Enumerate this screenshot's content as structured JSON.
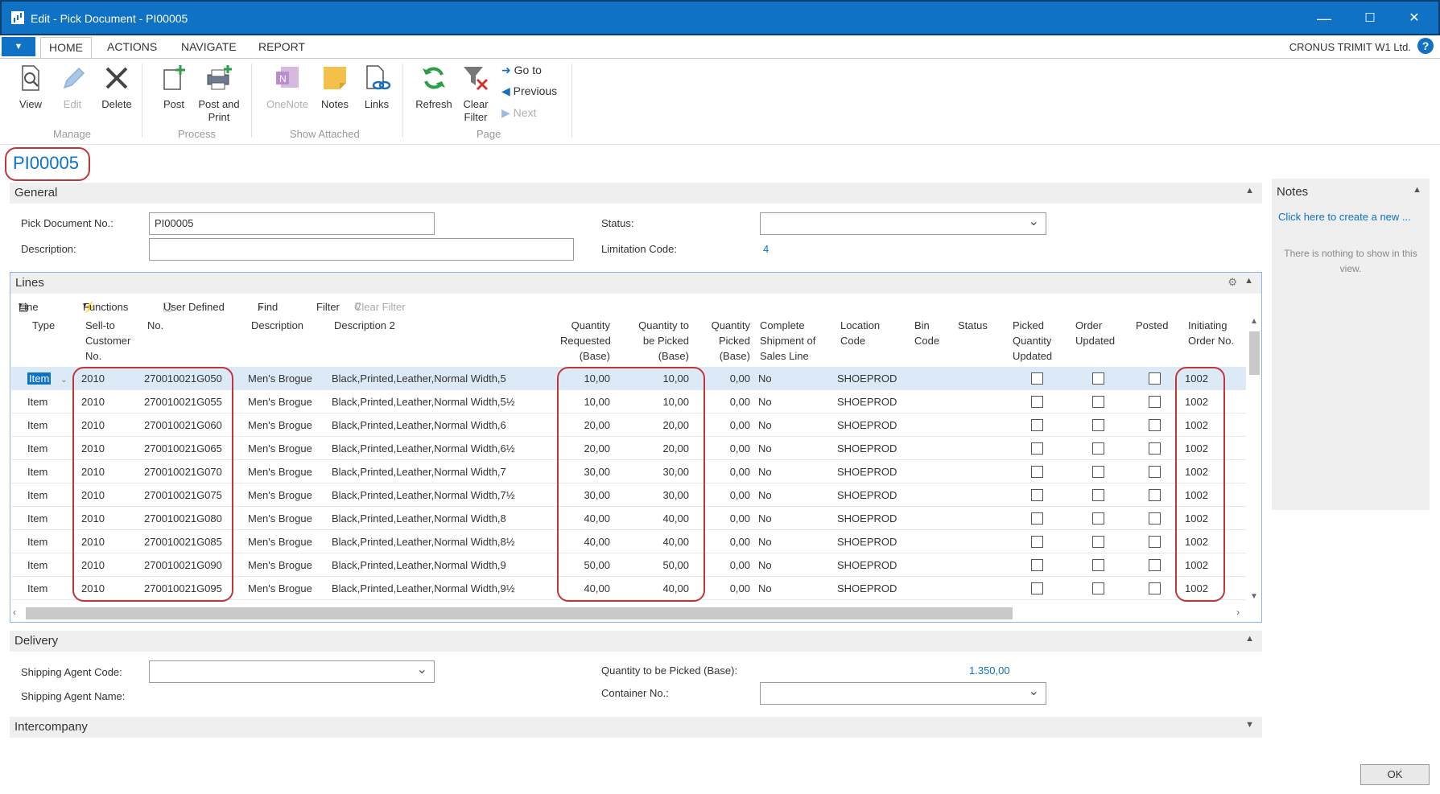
{
  "window": {
    "title": "Edit - Pick Document - PI00005",
    "minimize": "—",
    "maximize": "☐",
    "close": "✕"
  },
  "ribbon_tabs": [
    "HOME",
    "ACTIONS",
    "NAVIGATE",
    "REPORT"
  ],
  "company": "CRONUS TRIMIT W1 Ltd.",
  "ribbon": {
    "manage": {
      "label": "Manage",
      "view": "View",
      "edit": "Edit",
      "delete": "Delete"
    },
    "process": {
      "label": "Process",
      "post": "Post",
      "post_print_1": "Post and",
      "post_print_2": "Print"
    },
    "show_attached": {
      "label": "Show Attached",
      "onenote": "OneNote",
      "notes": "Notes",
      "links": "Links"
    },
    "page": {
      "label": "Page",
      "refresh": "Refresh",
      "clear_filter_1": "Clear",
      "clear_filter_2": "Filter",
      "go_to": "Go to",
      "previous": "Previous",
      "next": "Next"
    }
  },
  "page_title": "PI00005",
  "general": {
    "header": "General",
    "pick_doc_label": "Pick Document No.:",
    "pick_doc_value": "PI00005",
    "description_label": "Description:",
    "description_value": "",
    "status_label": "Status:",
    "status_value": "",
    "limitation_label": "Limitation Code:",
    "limitation_value": "4"
  },
  "lines": {
    "header": "Lines",
    "toolbar": {
      "line": "Line",
      "functions": "Functions",
      "user_defined": "User Defined",
      "find": "Find",
      "filter": "Filter",
      "clear_filter": "Clear Filter"
    },
    "columns": {
      "type": [
        "Type"
      ],
      "sell_to": [
        "Sell-to",
        "Customer",
        "No."
      ],
      "no": [
        "No."
      ],
      "description": [
        "Description"
      ],
      "description2": [
        "Description 2"
      ],
      "qty_requested": [
        "Quantity",
        "Requested",
        "(Base)"
      ],
      "qty_to_pick": [
        "Quantity to",
        "be Picked",
        "(Base)"
      ],
      "qty_picked": [
        "Quantity",
        "Picked",
        "(Base)"
      ],
      "complete_shipment": [
        "Complete",
        "Shipment of",
        "Sales Line"
      ],
      "location": [
        "Location",
        "Code"
      ],
      "bin": [
        "Bin",
        "Code"
      ],
      "status": [
        "Status"
      ],
      "picked_qty_updated": [
        "Picked",
        "Quantity",
        "Updated"
      ],
      "order_updated": [
        "Order",
        "Updated"
      ],
      "posted": [
        "Posted"
      ],
      "initiating": [
        "Initiating",
        "Order No."
      ]
    },
    "rows": [
      {
        "type": "Item",
        "sell_to": "2010",
        "no": "270010021G050",
        "description": "Men's Brogue",
        "description2": "Black,Printed,Leather,Normal Width,5",
        "qty_requested": "10,00",
        "qty_to_pick": "10,00",
        "qty_picked": "0,00",
        "complete": "No",
        "location": "SHOEPROD",
        "bin": "",
        "status": "",
        "picked_updated": false,
        "order_updated": false,
        "posted": false,
        "initiating": "1002"
      },
      {
        "type": "Item",
        "sell_to": "2010",
        "no": "270010021G055",
        "description": "Men's Brogue",
        "description2": "Black,Printed,Leather,Normal Width,5½",
        "qty_requested": "10,00",
        "qty_to_pick": "10,00",
        "qty_picked": "0,00",
        "complete": "No",
        "location": "SHOEPROD",
        "bin": "",
        "status": "",
        "picked_updated": false,
        "order_updated": false,
        "posted": false,
        "initiating": "1002"
      },
      {
        "type": "Item",
        "sell_to": "2010",
        "no": "270010021G060",
        "description": "Men's Brogue",
        "description2": "Black,Printed,Leather,Normal Width,6",
        "qty_requested": "20,00",
        "qty_to_pick": "20,00",
        "qty_picked": "0,00",
        "complete": "No",
        "location": "SHOEPROD",
        "bin": "",
        "status": "",
        "picked_updated": false,
        "order_updated": false,
        "posted": false,
        "initiating": "1002"
      },
      {
        "type": "Item",
        "sell_to": "2010",
        "no": "270010021G065",
        "description": "Men's Brogue",
        "description2": "Black,Printed,Leather,Normal Width,6½",
        "qty_requested": "20,00",
        "qty_to_pick": "20,00",
        "qty_picked": "0,00",
        "complete": "No",
        "location": "SHOEPROD",
        "bin": "",
        "status": "",
        "picked_updated": false,
        "order_updated": false,
        "posted": false,
        "initiating": "1002"
      },
      {
        "type": "Item",
        "sell_to": "2010",
        "no": "270010021G070",
        "description": "Men's Brogue",
        "description2": "Black,Printed,Leather,Normal Width,7",
        "qty_requested": "30,00",
        "qty_to_pick": "30,00",
        "qty_picked": "0,00",
        "complete": "No",
        "location": "SHOEPROD",
        "bin": "",
        "status": "",
        "picked_updated": false,
        "order_updated": false,
        "posted": false,
        "initiating": "1002"
      },
      {
        "type": "Item",
        "sell_to": "2010",
        "no": "270010021G075",
        "description": "Men's Brogue",
        "description2": "Black,Printed,Leather,Normal Width,7½",
        "qty_requested": "30,00",
        "qty_to_pick": "30,00",
        "qty_picked": "0,00",
        "complete": "No",
        "location": "SHOEPROD",
        "bin": "",
        "status": "",
        "picked_updated": false,
        "order_updated": false,
        "posted": false,
        "initiating": "1002"
      },
      {
        "type": "Item",
        "sell_to": "2010",
        "no": "270010021G080",
        "description": "Men's Brogue",
        "description2": "Black,Printed,Leather,Normal Width,8",
        "qty_requested": "40,00",
        "qty_to_pick": "40,00",
        "qty_picked": "0,00",
        "complete": "No",
        "location": "SHOEPROD",
        "bin": "",
        "status": "",
        "picked_updated": false,
        "order_updated": false,
        "posted": false,
        "initiating": "1002"
      },
      {
        "type": "Item",
        "sell_to": "2010",
        "no": "270010021G085",
        "description": "Men's Brogue",
        "description2": "Black,Printed,Leather,Normal Width,8½",
        "qty_requested": "40,00",
        "qty_to_pick": "40,00",
        "qty_picked": "0,00",
        "complete": "No",
        "location": "SHOEPROD",
        "bin": "",
        "status": "",
        "picked_updated": false,
        "order_updated": false,
        "posted": false,
        "initiating": "1002"
      },
      {
        "type": "Item",
        "sell_to": "2010",
        "no": "270010021G090",
        "description": "Men's Brogue",
        "description2": "Black,Printed,Leather,Normal Width,9",
        "qty_requested": "50,00",
        "qty_to_pick": "50,00",
        "qty_picked": "0,00",
        "complete": "No",
        "location": "SHOEPROD",
        "bin": "",
        "status": "",
        "picked_updated": false,
        "order_updated": false,
        "posted": false,
        "initiating": "1002"
      },
      {
        "type": "Item",
        "sell_to": "2010",
        "no": "270010021G095",
        "description": "Men's Brogue",
        "description2": "Black,Printed,Leather,Normal Width,9½",
        "qty_requested": "40,00",
        "qty_to_pick": "40,00",
        "qty_picked": "0,00",
        "complete": "No",
        "location": "SHOEPROD",
        "bin": "",
        "status": "",
        "picked_updated": false,
        "order_updated": false,
        "posted": false,
        "initiating": "1002"
      }
    ]
  },
  "delivery": {
    "header": "Delivery",
    "shipping_agent_code_label": "Shipping Agent Code:",
    "shipping_agent_code_value": "",
    "shipping_agent_name_label": "Shipping Agent Name:",
    "qty_to_pick_label": "Quantity to be Picked (Base):",
    "qty_to_pick_value": "1.350,00",
    "container_label": "Container No.:",
    "container_value": ""
  },
  "intercompany": {
    "header": "Intercompany"
  },
  "notes": {
    "header": "Notes",
    "create_link": "Click here to create a new ...",
    "empty_text": "There is nothing to show in this view."
  },
  "ok_label": "OK",
  "colors": {
    "accent": "#0f72c4",
    "annotation": "#c0373a",
    "fasttab_bg": "#efefef"
  }
}
